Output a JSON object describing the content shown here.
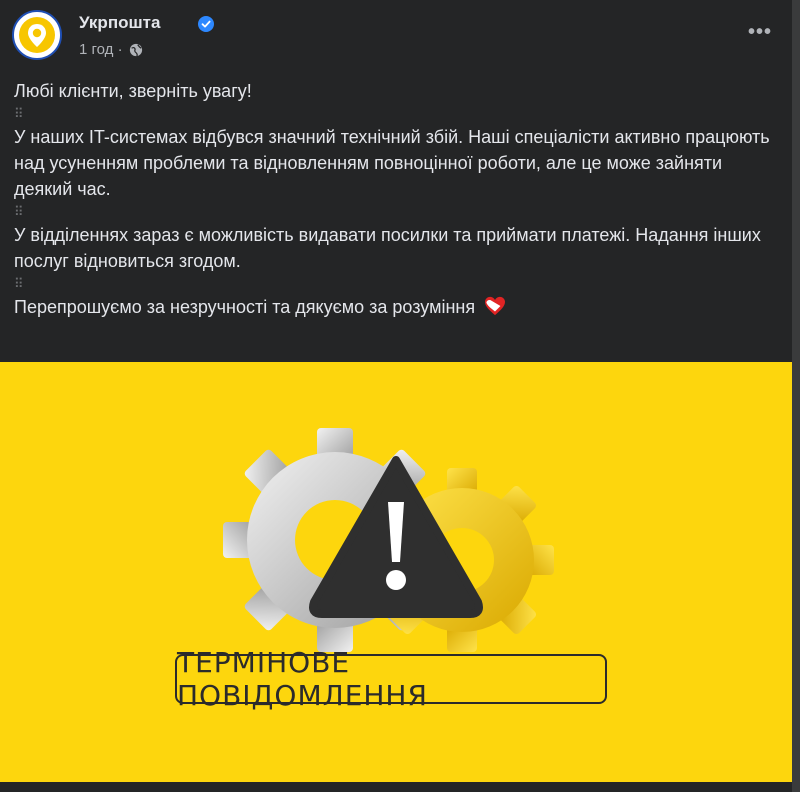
{
  "post": {
    "author": "Укрпошта",
    "time": "1 год ·",
    "paragraphs": [
      "Любі клієнти, зверніть увагу!",
      "У наших IT-системах відбувся значний технічний збій. Наші спеціалісти активно працюють над усуненням проблеми та відновленням повноцінної роботи, але це може зайняти деякий час.",
      "У відділеннях зараз є можливість видавати посилки та приймати платежі. Надання інших послуг відновиться згодом.",
      "Перепрошуємо за незручності та дякуємо за розуміння"
    ],
    "separator": "⠿",
    "more": "•••"
  },
  "banner": {
    "label": "ТЕРМІНОВЕ ПОВІДОМЛЕННЯ",
    "background": "#fdd60d"
  },
  "colors": {
    "card_bg": "#242526",
    "text": "#e4e6eb",
    "muted": "#b0b3b8",
    "verified": "#2d88ff",
    "brand_yellow": "#f7c600"
  }
}
